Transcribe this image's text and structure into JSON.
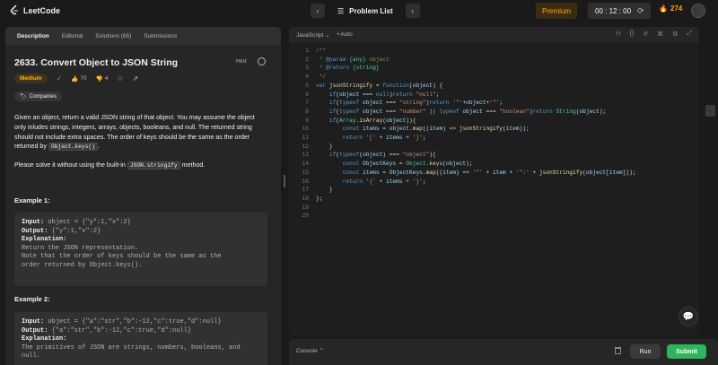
{
  "app": {
    "logo_text": "LeetCode"
  },
  "topnav": {
    "problem_list": "Problem List",
    "premium": "Premium",
    "timer": "00 : 12 : 00",
    "streak": "274"
  },
  "tabs": [
    "Description",
    "Editorial",
    "Solutions (65)",
    "Submissions"
  ],
  "problem": {
    "title": "2633. Convert Object to JSON String",
    "hint": "Hint",
    "difficulty": "Medium",
    "likes": "70",
    "dislikes": "4",
    "companies": "Companies",
    "p1a": "Given an object, return a valid JSON string of that object. You may assume the object only inludes strings, integers, arrays, objects, booleans, and null. The returned string should not include extra spaces. The order of keys should be the same as the order returned by ",
    "p1code": "Object.keys()",
    "p1end": ".",
    "p2a": "Please solve it without using the built-in ",
    "p2code": "JSON.stringify",
    "p2b": " method.",
    "ex1_heading": "Example 1:",
    "ex1": {
      "input_label": "Input:",
      "input": " object = {\"y\":1,\"x\":2}",
      "output_label": "Output:",
      "output": " {\"y\":1,\"x\":2}",
      "expl_label": "Explanation:",
      "expl1": "Return the JSON representation.",
      "expl2": "Note that the order of keys should be the same as the",
      "expl3": "order returned by Object.keys()."
    },
    "ex2_heading": "Example 2:",
    "ex2": {
      "input_label": "Input:",
      "input": " object = {\"a\":\"str\",\"b\":-12,\"c\":true,\"d\":null}",
      "output_label": "Output:",
      "output": " {\"a\":\"str\",\"b\":-12,\"c\":true,\"d\":null}",
      "expl_label": "Explanation:",
      "expl1": "The primitives of JSON are strings, numbers, booleans, and",
      "expl2": "null."
    }
  },
  "editor": {
    "language": "JavaScript",
    "mode": "Auto",
    "line_numbers": [
      "1",
      "2",
      "3",
      "4",
      "5",
      "6",
      "7",
      "8",
      "9",
      "10",
      "11",
      "12",
      "13",
      "14",
      "15",
      "16",
      "17",
      "18",
      "19",
      "20"
    ]
  },
  "console": {
    "label": "Console",
    "run": "Run",
    "submit": "Submit"
  },
  "colors": {
    "accent": "#ffa116",
    "medium": "#ffb800",
    "submit": "#2db55d"
  },
  "icons": [
    "leetcode-logo-icon",
    "chevron-left-icon",
    "chevron-right-icon",
    "list-icon",
    "reset-icon",
    "fire-icon",
    "info-icon",
    "check-circle-icon",
    "thumbs-up-icon",
    "thumbs-down-icon",
    "star-icon",
    "share-icon",
    "tag-icon",
    "bookmark-icon",
    "braces-icon",
    "undo-icon",
    "settings-icon",
    "expand-icon",
    "chat-icon",
    "trash-icon",
    "file-icon"
  ]
}
